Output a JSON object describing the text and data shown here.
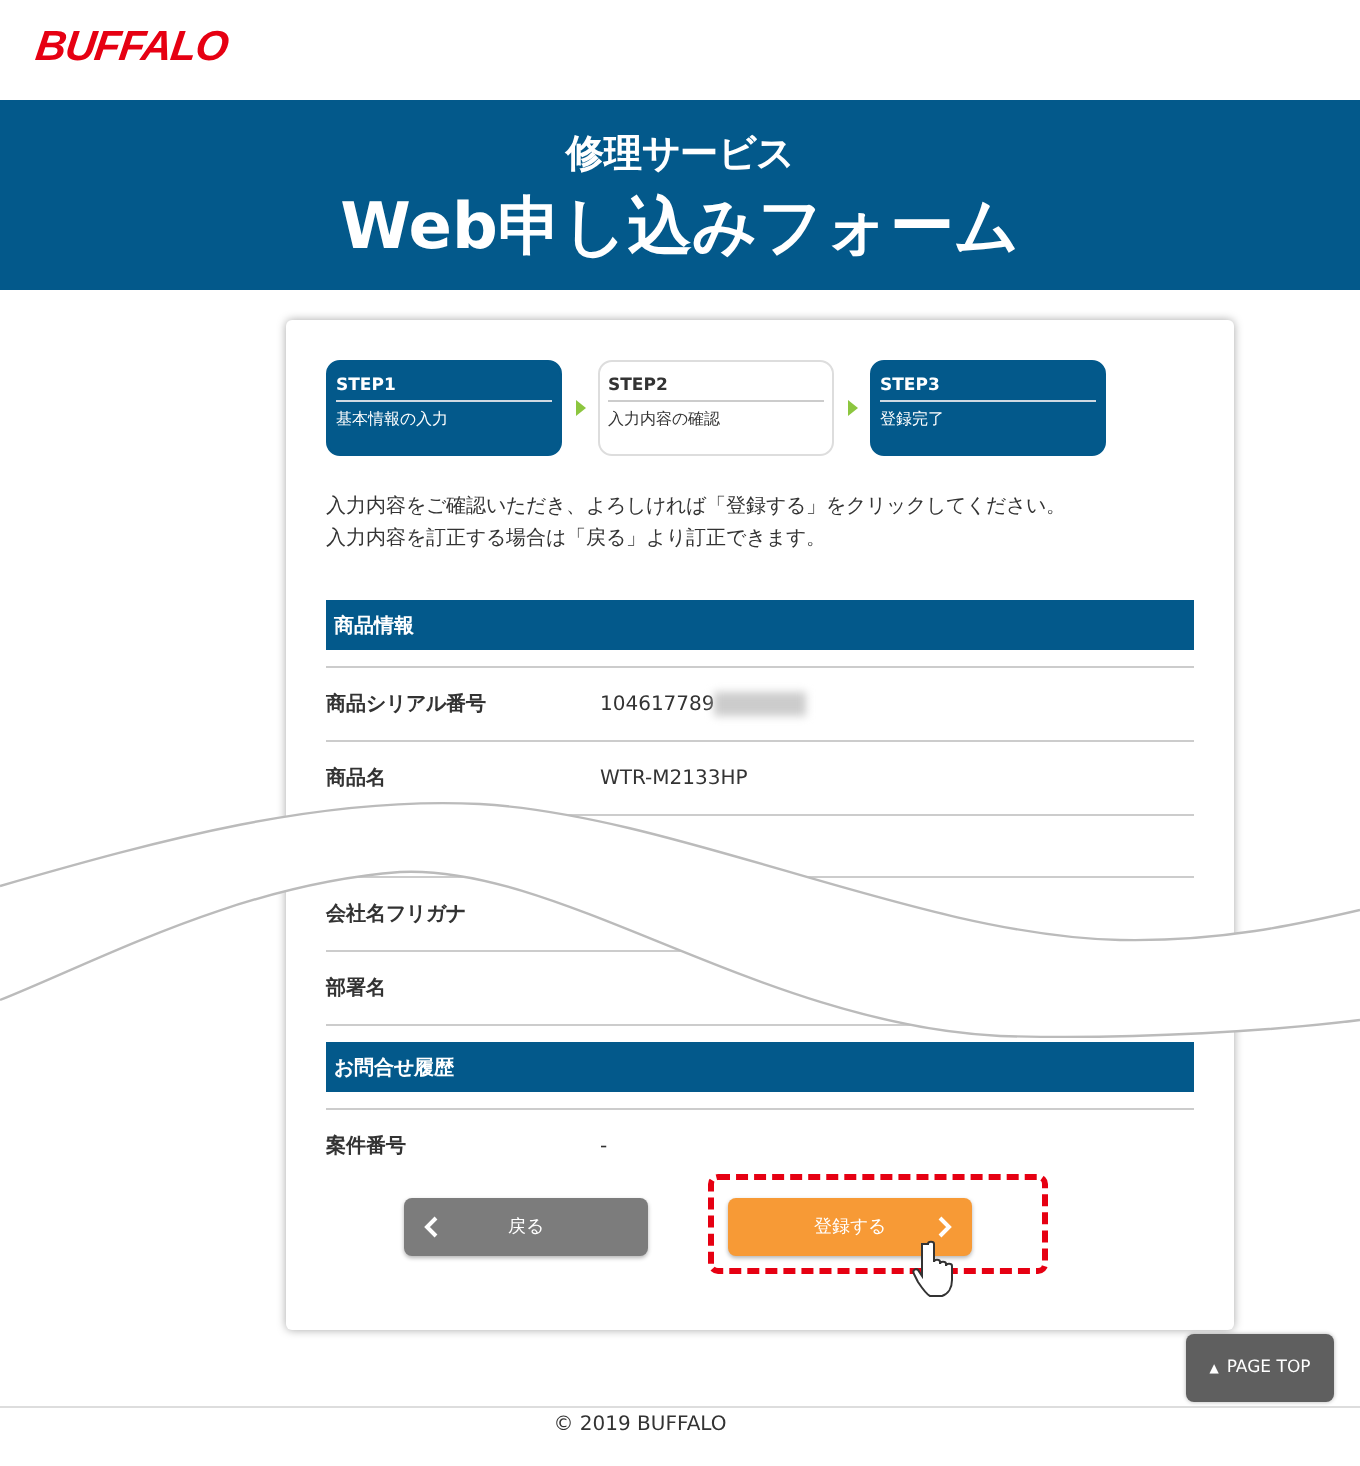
{
  "logo": {
    "text": "BUFFALO"
  },
  "banner": {
    "subtitle": "修理サービス",
    "title": "Web申し込みフォーム"
  },
  "steps": [
    {
      "label": "STEP1",
      "caption": "基本情報の入力",
      "selected": false
    },
    {
      "label": "STEP2",
      "caption": "入力内容の確認",
      "selected": true
    },
    {
      "label": "STEP3",
      "caption": "登録完了",
      "selected": false
    }
  ],
  "intro": [
    "入力内容をご確認いただき、よろしければ「登録する」をクリックしてください。",
    "入力内容を訂正する場合は「戻る」より訂正できます。"
  ],
  "sections": [
    {
      "heading": "商品情報",
      "rows": [
        {
          "label": "商品シリアル番号",
          "value": "104617789",
          "redacted": true
        },
        {
          "label": "商品名",
          "value": "WTR-M2133HP"
        },
        {
          "kind": "hidden"
        },
        {
          "label": "会社名フリガナ"
        },
        {
          "label": "部署名"
        }
      ]
    },
    {
      "heading": "お問合せ履歴",
      "rows": [
        {
          "label": "案件番号",
          "value": "-"
        }
      ]
    }
  ],
  "buttons": [
    {
      "kind": "back",
      "label": "戻る",
      "highlighted": false
    },
    {
      "kind": "submit",
      "label": "登録する",
      "highlighted": true
    }
  ],
  "page_top": {
    "icon": "▲",
    "label": "PAGE TOP"
  },
  "footer": {
    "copyright": "© 2019 BUFFALO"
  }
}
